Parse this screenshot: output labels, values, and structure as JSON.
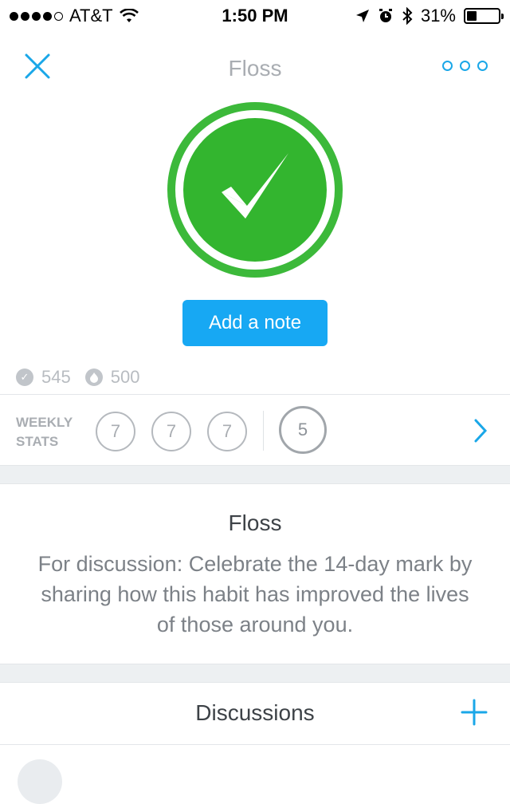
{
  "status_bar": {
    "carrier": "AT&T",
    "time": "1:50 PM",
    "battery": "31%",
    "battery_level": 0.31,
    "signal_bars": 4
  },
  "nav": {
    "title": "Floss",
    "close_icon": "close-icon",
    "more_icon": "more-icon"
  },
  "check": {
    "icon": "checkmark-icon",
    "color": "#3cb93a"
  },
  "add_note": {
    "label": "Add a note",
    "color": "#17a8f3"
  },
  "counts": {
    "checkins": "545",
    "streak": "500"
  },
  "weekly": {
    "label_line1": "WEEKLY",
    "label_line2": "STATS",
    "past": [
      "7",
      "7",
      "7"
    ],
    "current": "5"
  },
  "card": {
    "title": "Floss",
    "description": "For discussion: Celebrate the 14-day mark by sharing how this habit has improved the lives of those around you."
  },
  "discussions": {
    "title": "Discussions"
  },
  "colors": {
    "accent": "#1aa7e8",
    "green": "#3cb93a",
    "muted": "#a9adb2"
  }
}
